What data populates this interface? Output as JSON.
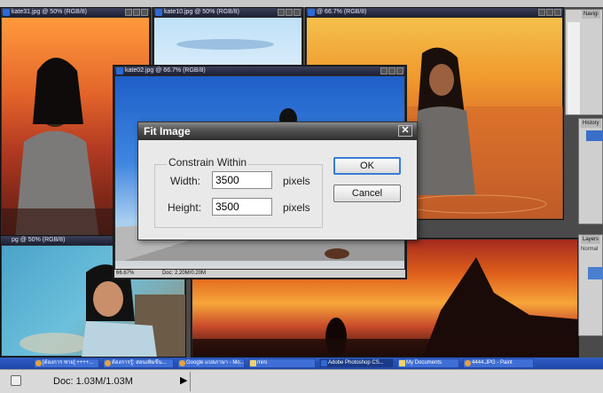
{
  "windows": [
    {
      "title": "kate31.jpg @ 50% (RGB/8)"
    },
    {
      "title": "kate10.jpg @ 50% (RGB/8)"
    },
    {
      "title": "@ 66.7% (RGB/8)"
    },
    {
      "title": "kate02.jpg @ 66.7% (RGB/8)"
    }
  ],
  "lower_left_title": "pg @ 50% (RGB/8)",
  "doc_window": {
    "zoom": "66.67%",
    "doc_info": "Doc: 2.20M/0.20M"
  },
  "dialog": {
    "title": "Fit Image",
    "group_label": "Constrain Within",
    "width_label": "Width:",
    "width_value": "3500",
    "width_unit": "pixels",
    "height_label": "Height:",
    "height_value": "3500",
    "height_unit": "pixels",
    "ok_label": "OK",
    "cancel_label": "Cancel"
  },
  "panels": {
    "navigator_tab": "Navigi",
    "history_tab": "History",
    "layers_tab": "Layers",
    "layers_mode": "Normal"
  },
  "taskbar": [
    {
      "label": "[ต้องการ ซาย] ++++..."
    },
    {
      "label": "ต้องการรู้: สอนเพิ่มขึ้น..."
    },
    {
      "label": "Google แปลภาษา - Mo..."
    },
    {
      "label": "mini"
    },
    {
      "label": "Adobe Photoshop CS...",
      "active": true
    },
    {
      "label": "My Documents"
    },
    {
      "label": "4444.JPG - Paint"
    }
  ],
  "statusbar": {
    "doc_info": "Doc: 1.03M/1.03M"
  },
  "colors": {
    "dialog_bg": "#e9e9e9",
    "ok_border": "#3a7bd5",
    "taskbar": "#2a55b8"
  }
}
